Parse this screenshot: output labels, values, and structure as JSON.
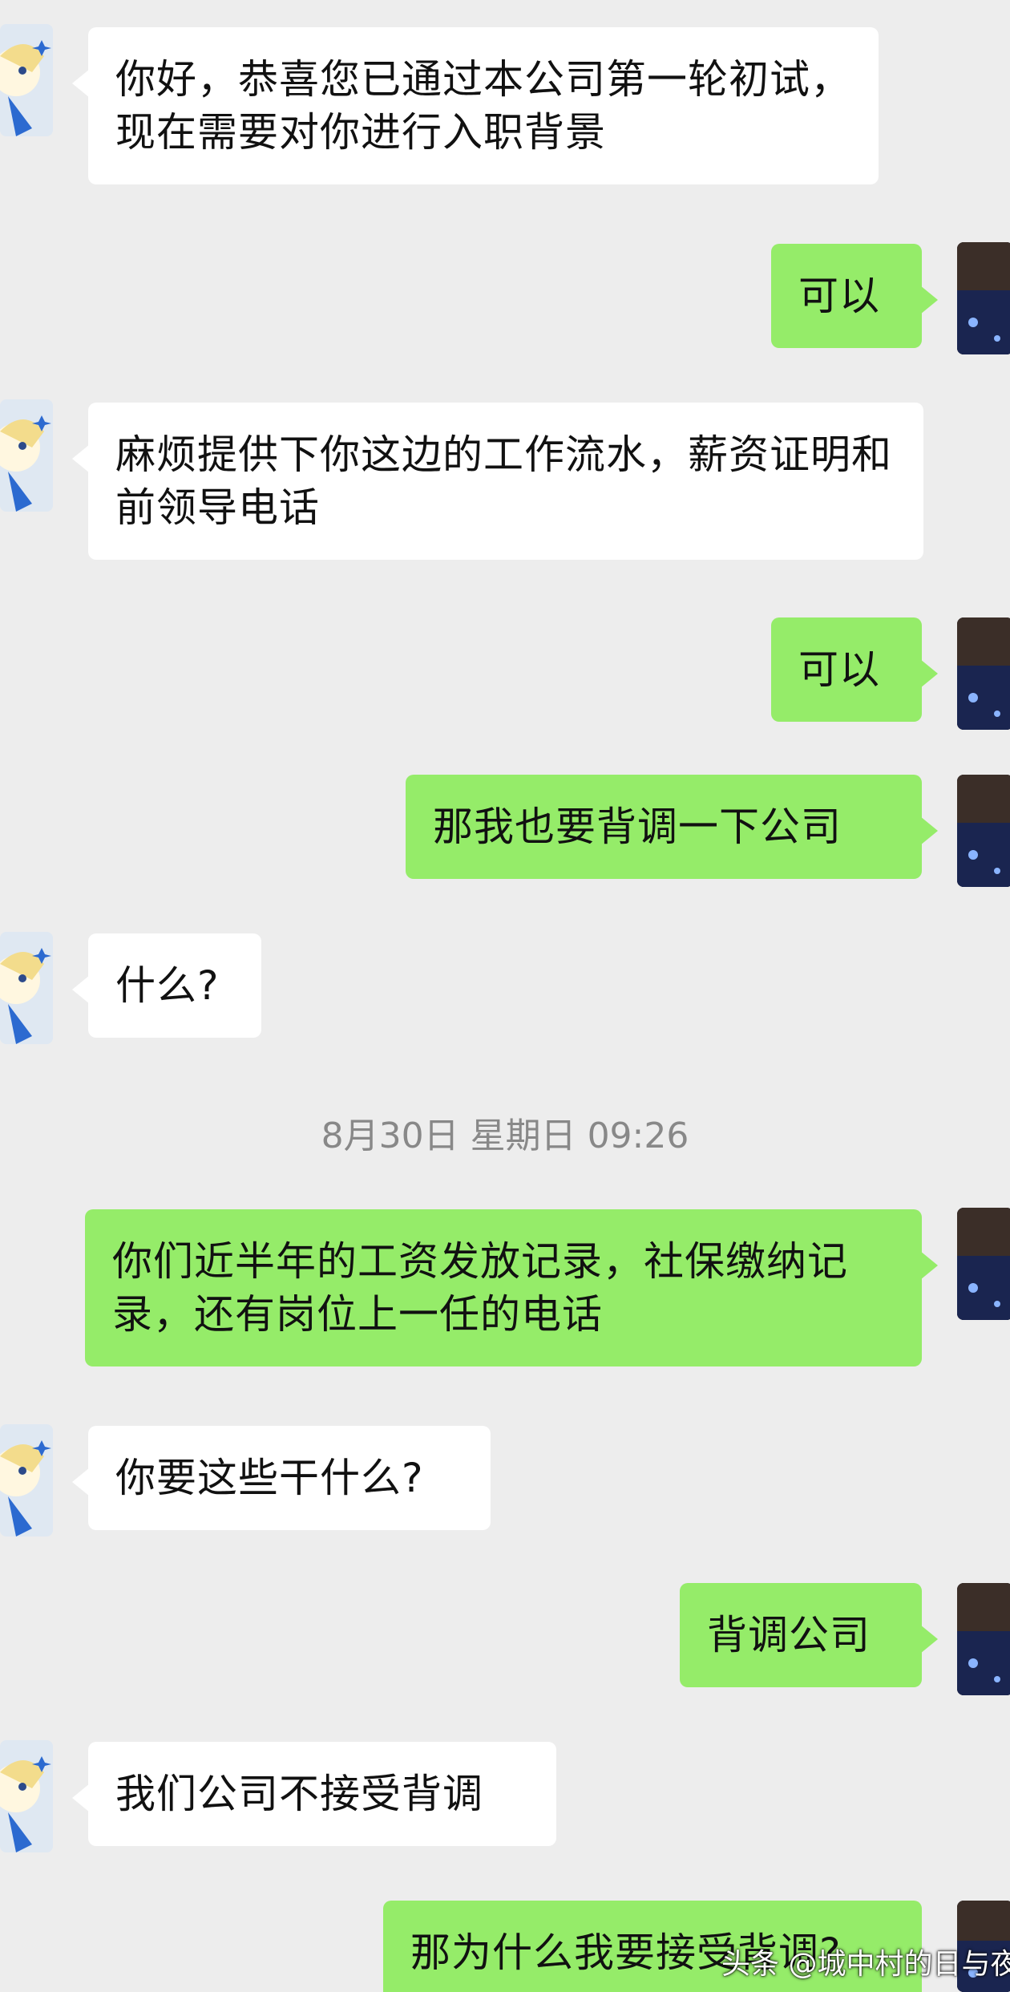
{
  "messages": [
    {
      "side": "left",
      "text": "你好，恭喜您已通过本公司第一轮初试，现在需要对你进行入职背景"
    },
    {
      "side": "right",
      "text": "可以"
    },
    {
      "side": "left",
      "text": "麻烦提供下你这边的工作流水，薪资证明和前领导电话"
    },
    {
      "side": "right",
      "text": "可以"
    },
    {
      "side": "right",
      "text": "那我也要背调一下公司"
    },
    {
      "side": "left",
      "text": "什么?"
    },
    {
      "side": "right",
      "text": "你们近半年的工资发放记录，社保缴纳记录，还有岗位上一任的电话"
    },
    {
      "side": "left",
      "text": "你要这些干什么?"
    },
    {
      "side": "right",
      "text": "背调公司"
    },
    {
      "side": "left",
      "text": "我们公司不接受背调"
    },
    {
      "side": "right",
      "text": "那为什么我要接受背调?"
    }
  ],
  "timestamp": "8月30日 星期日 09:26",
  "watermark": "头条 @城中村的日与夜",
  "colors": {
    "background": "#ededed",
    "incoming_bubble": "#ffffff",
    "outgoing_bubble": "#95ec69"
  },
  "icons": {
    "left_avatar": "cartoon-character-avatar",
    "right_avatar": "dark-photo-avatar"
  }
}
